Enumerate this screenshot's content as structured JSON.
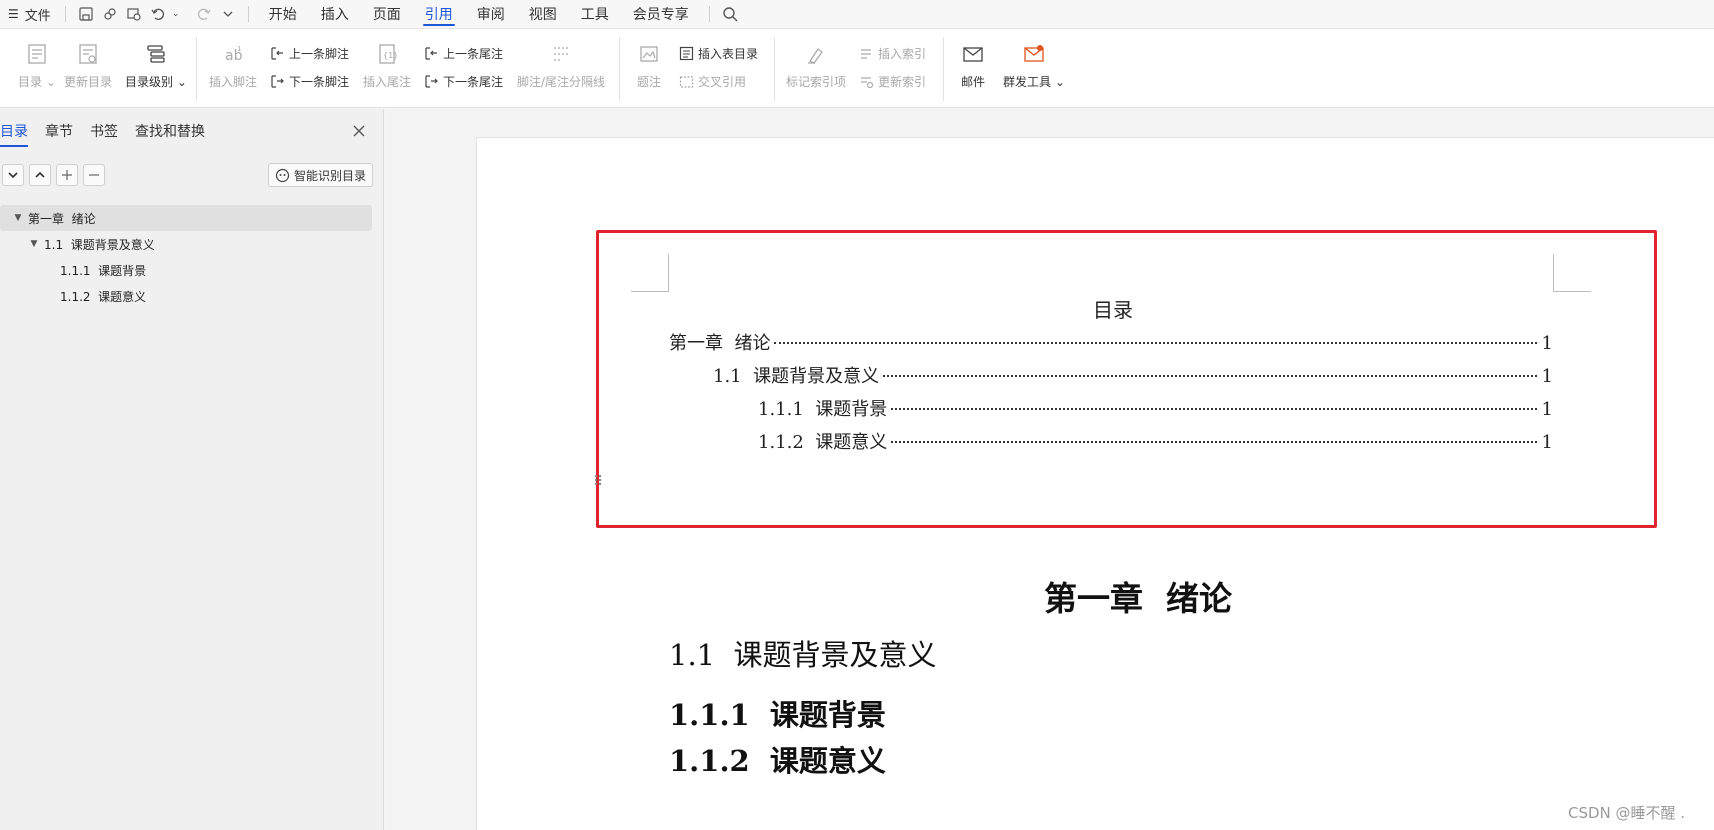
{
  "menubar": {
    "file_label": "文件",
    "tabs": [
      "开始",
      "插入",
      "页面",
      "引用",
      "审阅",
      "视图",
      "工具",
      "会员专享"
    ],
    "active_tab": "引用"
  },
  "ribbon": {
    "toc": "目录",
    "update_toc": "更新目录",
    "toc_level": "目录级别",
    "insert_footnote": "插入脚注",
    "prev_footnote": "上一条脚注",
    "next_footnote": "下一条脚注",
    "insert_endnote": "插入尾注",
    "prev_endnote": "上一条尾注",
    "next_endnote": "下一条尾注",
    "separator": "脚注/尾注分隔线",
    "caption": "题注",
    "insert_table_of_figures": "插入表目录",
    "cross_reference": "交叉引用",
    "mark_index_entry": "标记索引项",
    "insert_index": "插入索引",
    "update_index": "更新索引",
    "mail": "邮件",
    "mass_send": "群发工具"
  },
  "navpanel": {
    "tabs": [
      "目录",
      "章节",
      "书签",
      "查找和替换"
    ],
    "smart_toc_label": "智能识别目录",
    "tree": [
      {
        "label": "第一章  绪论",
        "level": 0,
        "expanded": true,
        "selected": true
      },
      {
        "label": "1.1  课题背景及意义",
        "level": 1,
        "expanded": true,
        "selected": false
      },
      {
        "label": "1.1.1  课题背景",
        "level": 2,
        "expanded": false,
        "selected": false
      },
      {
        "label": "1.1.2  课题意义",
        "level": 2,
        "expanded": false,
        "selected": false
      }
    ]
  },
  "document": {
    "toc_title": "目录",
    "toc_entries": [
      {
        "text": "第一章  绪论",
        "page": "1"
      },
      {
        "text": "1.1  课题背景及意义",
        "page": "1"
      },
      {
        "text": "1.1.1  课题背景",
        "page": "1"
      },
      {
        "text": "1.1.2  课题意义",
        "page": "1"
      }
    ],
    "heading1": "第一章  绪论",
    "heading2": "1.1  课题背景及意义",
    "heading3a": "1.1.1  课题背景",
    "heading3b": "1.1.2  课题意义"
  },
  "watermark": "CSDN @睡不醒 .",
  "colors": {
    "accent": "#1f57d8",
    "highlight_box": "#e0232d"
  }
}
